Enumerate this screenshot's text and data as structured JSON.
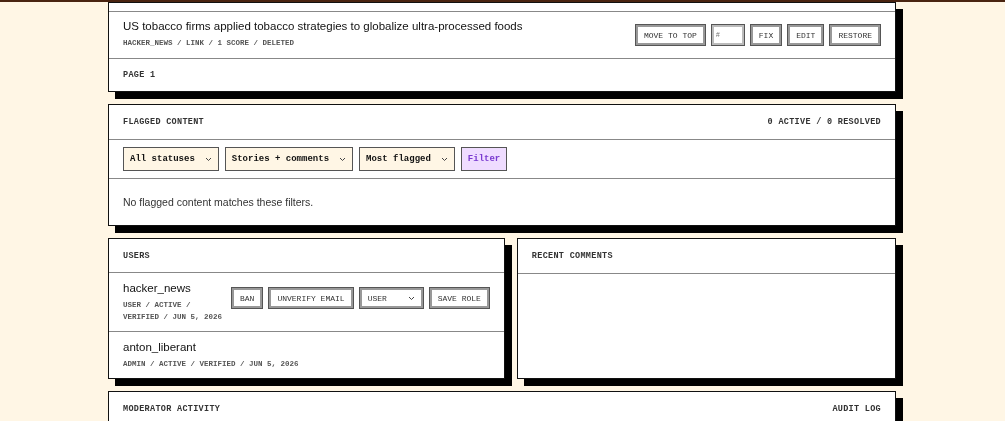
{
  "stories_panel": {
    "story": {
      "title": "US tobacco firms applied tobacco strategies to globalize ultra-processed foods",
      "meta": "HACKER_NEWS / LINK / 1 SCORE / DELETED",
      "move_button": "MOVE TO TOP",
      "position_field": {
        "placeholder": "#"
      },
      "buttons": [
        "FIX",
        "EDIT",
        "RESTORE"
      ]
    },
    "pager": "PAGE 1"
  },
  "flagged_panel": {
    "title": "FLAGGED CONTENT",
    "summary": "0 ACTIVE / 0 RESOLVED",
    "filters": [
      {
        "value": "All statuses"
      },
      {
        "value": "Stories + comments"
      },
      {
        "value": "Most flagged"
      }
    ],
    "filter_button": "Filter",
    "empty_message": "No flagged content matches these filters."
  },
  "users_panel": {
    "title": "USERS",
    "users": [
      {
        "name": "hacker_news",
        "meta": "USER / ACTIVE / VERIFIED / JUN 5, 2026",
        "actions": {
          "ban": "BAN",
          "unverify": "UNVERIFY EMAIL",
          "role": "USER",
          "save": "SAVE ROLE"
        }
      },
      {
        "name": "anton_liberant",
        "meta": "ADMIN / ACTIVE / VERIFIED / JUN 5, 2026"
      }
    ]
  },
  "comments_panel": {
    "title": "RECENT COMMENTS"
  },
  "moderator_panel": {
    "title": "MODERATOR ACTIVITY",
    "link": "AUDIT LOG"
  }
}
